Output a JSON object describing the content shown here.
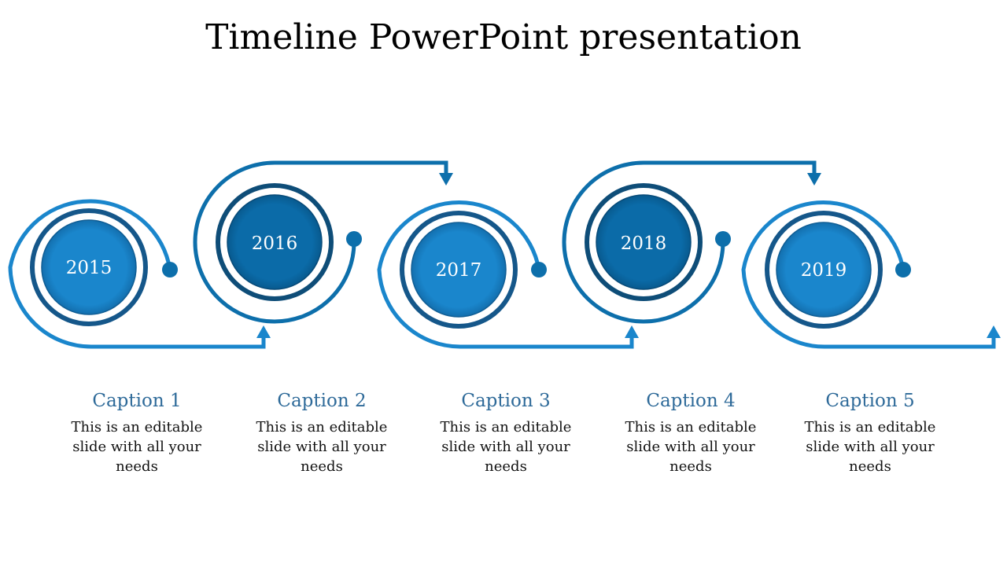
{
  "title": "Timeline PowerPoint presentation",
  "colors": {
    "light_blue": "#1a86cc",
    "mid_blue": "#0d6fab",
    "dark_ring": "#15578a",
    "caption": "#2e6a99"
  },
  "milestones": [
    {
      "year": "2015",
      "caption": "Caption 1",
      "body": "This is an editable slide with all your needs"
    },
    {
      "year": "2016",
      "caption": "Caption 2",
      "body": "This is an editable slide with all your needs"
    },
    {
      "year": "2017",
      "caption": "Caption 3",
      "body": "This is an editable slide with all your needs"
    },
    {
      "year": "2018",
      "caption": "Caption 4",
      "body": "This is an editable slide with all your needs"
    },
    {
      "year": "2019",
      "caption": "Caption 5",
      "body": "This is an editable slide with all your needs"
    }
  ]
}
